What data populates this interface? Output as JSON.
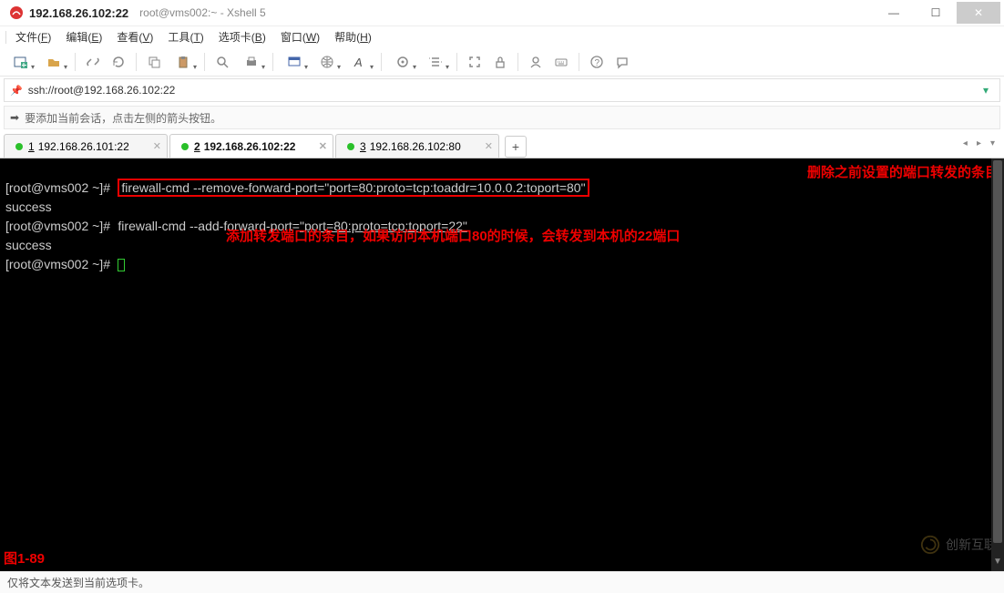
{
  "window": {
    "title_main": "192.168.26.102:22",
    "title_sub": "root@vms002:~ - Xshell 5"
  },
  "menu": {
    "file": "文件",
    "file_key": "F",
    "edit": "编辑",
    "edit_key": "E",
    "view": "查看",
    "view_key": "V",
    "tools": "工具",
    "tools_key": "T",
    "tabs": "选项卡",
    "tabs_key": "B",
    "window": "窗口",
    "window_key": "W",
    "help": "帮助",
    "help_key": "H"
  },
  "toolbar_icons": [
    "new-session-icon",
    "open-icon",
    "link-icon",
    "reload-icon",
    "copy-icon",
    "paste-icon",
    "search-icon",
    "print-icon",
    "screen-icon",
    "globe-icon",
    "font-icon",
    "ext-icon",
    "arrows-icon",
    "cols-icon",
    "fullscreen-icon",
    "lock-icon",
    "user-icon",
    "keyboard-icon",
    "help-icon",
    "chat-icon"
  ],
  "address": {
    "url": "ssh://root@192.168.26.102:22"
  },
  "infobar": {
    "text": "要添加当前会话，点击左侧的箭头按钮。"
  },
  "tabs": [
    {
      "num": "1",
      "label": "192.168.26.101:22",
      "active": false
    },
    {
      "num": "2",
      "label": "192.168.26.102:22",
      "active": true
    },
    {
      "num": "3",
      "label": "192.168.26.102:80",
      "active": false
    }
  ],
  "term": {
    "p1": "[root@vms002 ~]#",
    "cmd1": "firewall-cmd --remove-forward-port=\"port=80:proto=tcp:toaddr=10.0.0.2:toport=80\"",
    "out1": "success",
    "p2": "[root@vms002 ~]#",
    "cmd2a": "firewall-cmd --add-forward-port=",
    "cmd2b": "\"port=80:proto=tcp:toport=22\"",
    "out2": "success",
    "p3": "[root@vms002 ~]#",
    "anno1": "删除之前设置的端口转发的条目",
    "anno2": "添加转发端口的条目，如果访问本机端口80的时候，会转发到本机的22端口",
    "fig": "图1-89",
    "watermark": "创新互联"
  },
  "status": {
    "text": "仅将文本发送到当前选项卡。"
  }
}
